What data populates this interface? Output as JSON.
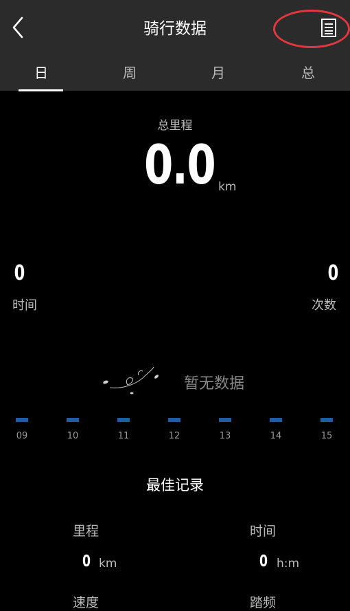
{
  "header": {
    "title": "骑行数据",
    "back_icon": "chevron-left-icon",
    "list_icon": "document-list-icon",
    "highlight_color": "#e0383e"
  },
  "tabs": [
    {
      "label": "日",
      "active": true
    },
    {
      "label": "周",
      "active": false
    },
    {
      "label": "月",
      "active": false
    },
    {
      "label": "总",
      "active": false
    }
  ],
  "summary": {
    "total_label": "总里程",
    "total_value": "0.0",
    "total_unit": "km",
    "time_value": "0",
    "time_label": "时间",
    "count_value": "0",
    "count_label": "次数"
  },
  "chart_data": {
    "type": "bar",
    "categories": [
      "09",
      "10",
      "11",
      "12",
      "13",
      "14",
      "15"
    ],
    "values": [
      0,
      0,
      0,
      0,
      0,
      0,
      0
    ],
    "empty_message": "暂无数据",
    "bar_color": "#1e5ea8"
  },
  "best": {
    "title": "最佳记录",
    "distance_label": "里程",
    "distance_value": "0",
    "distance_unit": "km",
    "time_label": "时间",
    "time_value": "0",
    "time_unit": "h:m",
    "speed_label": "速度",
    "cadence_label": "踏频"
  }
}
